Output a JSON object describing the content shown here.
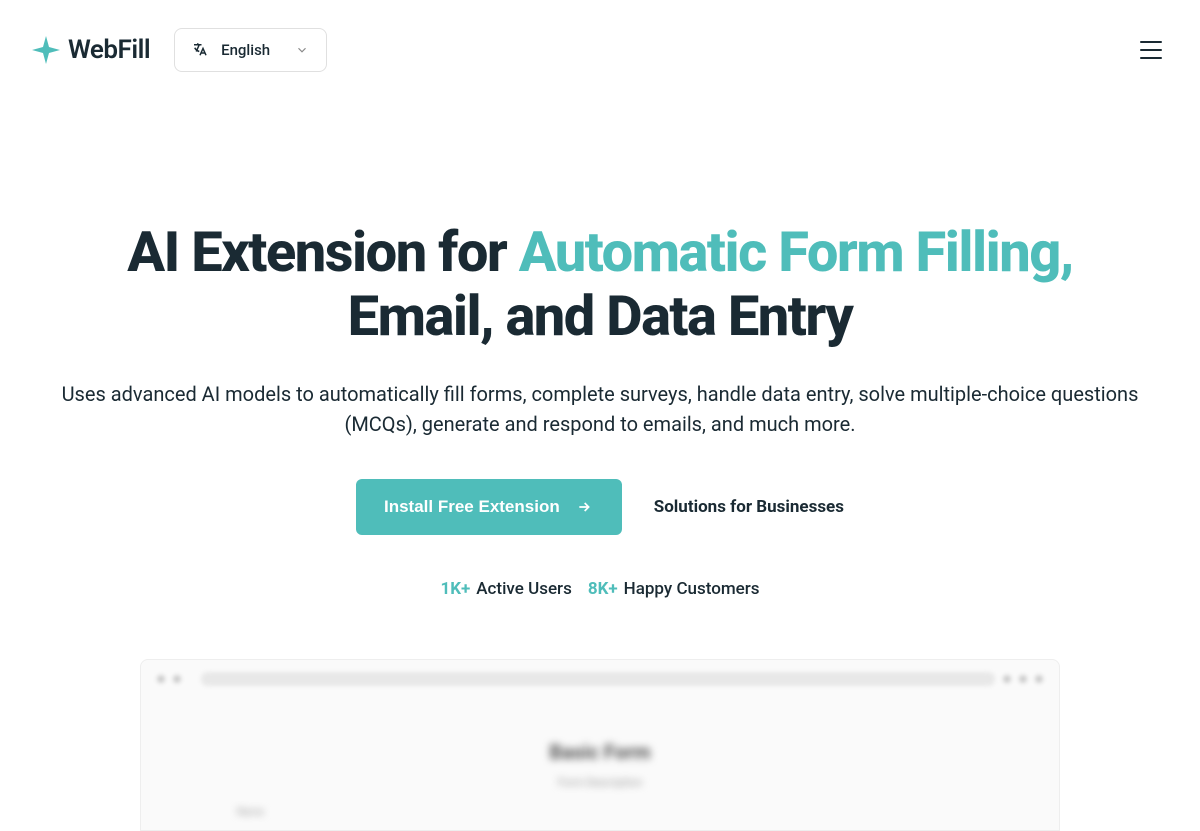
{
  "header": {
    "logo_text": "WebFill",
    "language": {
      "selected": "English"
    }
  },
  "hero": {
    "title_part1": "AI Extension for ",
    "title_highlight": "Automatic Form Filling,",
    "title_part2": " Email, and Data Entry",
    "subtitle": "Uses advanced AI models to automatically fill forms, complete surveys, handle data entry, solve multiple-choice questions (MCQs), generate and respond to emails, and much more.",
    "primary_cta": "Install Free Extension",
    "secondary_cta": "Solutions for Businesses"
  },
  "stats": {
    "users_value": "1K+",
    "users_label": "Active Users",
    "customers_value": "8K+",
    "customers_label": "Happy Customers"
  },
  "demo": {
    "title": "Basic Form",
    "subtitle": "Form Description",
    "field_label": "Name"
  }
}
